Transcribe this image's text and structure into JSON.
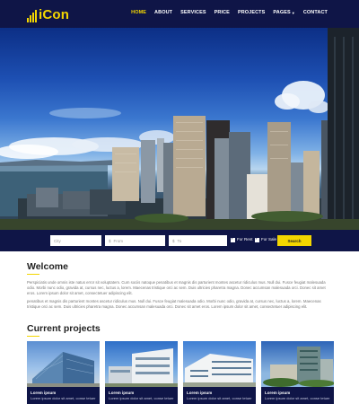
{
  "brand": {
    "name": "iCon",
    "accent": "#f3d600",
    "navy": "#0f1547"
  },
  "nav": {
    "items": [
      {
        "label": "HOME",
        "active": true
      },
      {
        "label": "ABOUT"
      },
      {
        "label": "SERVICES"
      },
      {
        "label": "PRICE"
      },
      {
        "label": "PROJECTS"
      },
      {
        "label": "PAGES",
        "has_dropdown": true
      },
      {
        "label": "CONTACT"
      }
    ]
  },
  "search": {
    "city_placeholder": "City",
    "from_prefix": "$",
    "from_placeholder": "From",
    "to_prefix": "$",
    "to_placeholder": "To",
    "for_rent_label": "For Rent",
    "for_sale_label": "For Sale",
    "search_label": "Search"
  },
  "welcome": {
    "title": "Welcome",
    "paragraph1": "Perspiciatis unde omnis iste natus error sit voluptatem. Cum sociis natoque penatibus et magnis dis parturient montes ascetur ridiculus mus. Null dui. Fusce feugiat malesuada odio. Morbi nunc odio, gravida at, cursus nec, luctus a, lorem. Maecenas tristique orci ac sem. Duis ultricies pharetra magna. Donec accumsan malesuada orci. Donec sit amet eros. Lorem ipsum dolor sit amet, consectetuer adipiscing elit.",
    "paragraph2": "penatibus et magnis dis parturient montes ascetur ridiculus mus. Null dui. Fusce feugiat malesuada odio. Morbi nunc odio, gravida at, cursus nec, luctus a, lorem. Maecenas tristique orci ac sem. Duis ultricies pharetra magna. Donec accumsan malesuada orci. Donec sit amet eros. Lorem ipsum dolor sit amet, consectetuer adipiscing elit."
  },
  "projects": {
    "title": "Current projects",
    "items": [
      {
        "title": "Lorem ipsum",
        "desc": "Lorem ipsum dolor sit amet, conse tetuer"
      },
      {
        "title": "Lorem ipsum",
        "desc": "Lorem ipsum dolor sit amet, conse tetuer"
      },
      {
        "title": "Lorem ipsum",
        "desc": "Lorem ipsum dolor sit amet, conse tetuer"
      },
      {
        "title": "Lorem ipsum",
        "desc": "Lorem ipsum dolor sit amet, conse tetuer"
      }
    ]
  }
}
